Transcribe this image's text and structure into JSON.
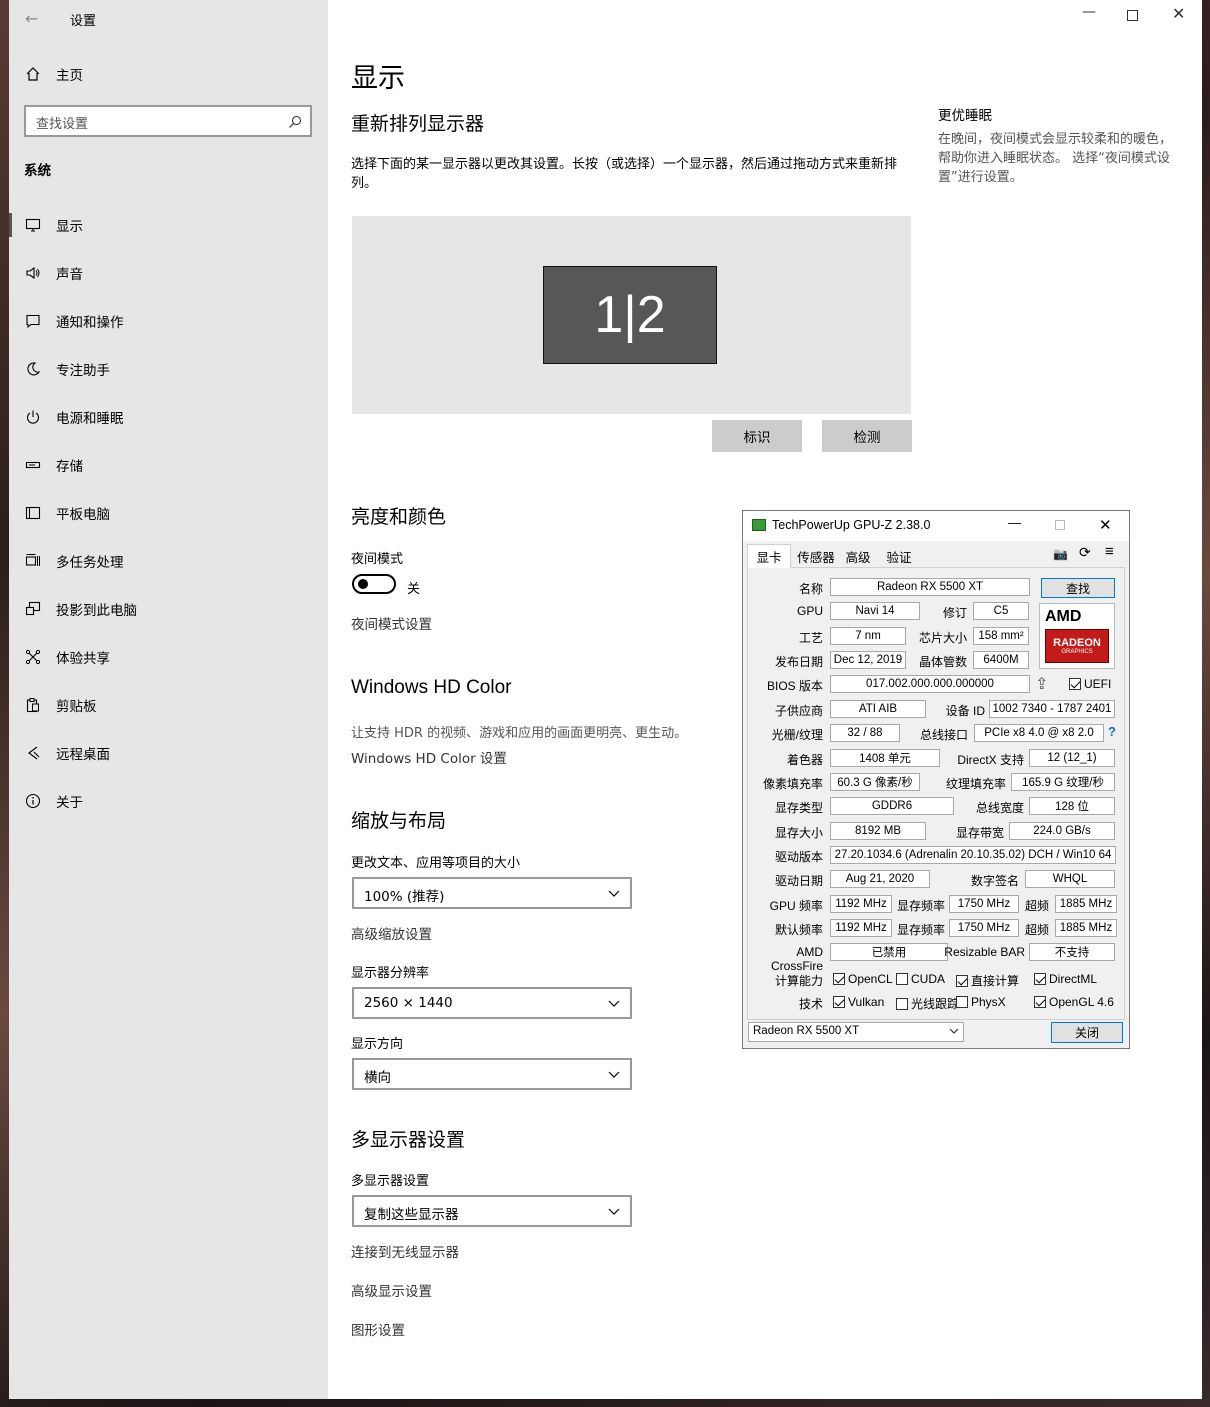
{
  "settings": {
    "title": "设置",
    "home": "主页",
    "search_placeholder": "查找设置",
    "section": "系统",
    "nav": [
      {
        "label": "显示",
        "icon": "monitor-icon"
      },
      {
        "label": "声音",
        "icon": "speaker-icon"
      },
      {
        "label": "通知和操作",
        "icon": "notification-icon"
      },
      {
        "label": "专注助手",
        "icon": "moon-icon"
      },
      {
        "label": "电源和睡眠",
        "icon": "power-icon"
      },
      {
        "label": "存储",
        "icon": "storage-icon"
      },
      {
        "label": "平板电脑",
        "icon": "tablet-icon"
      },
      {
        "label": "多任务处理",
        "icon": "multitask-icon"
      },
      {
        "label": "投影到此电脑",
        "icon": "project-icon"
      },
      {
        "label": "体验共享",
        "icon": "share-icon"
      },
      {
        "label": "剪贴板",
        "icon": "clipboard-icon"
      },
      {
        "label": "远程桌面",
        "icon": "remote-icon"
      },
      {
        "label": "关于",
        "icon": "info-icon"
      }
    ],
    "page_title": "显示",
    "rearrange_heading": "重新排列显示器",
    "rearrange_desc": "选择下面的某一显示器以更改其设置。长按（或选择）一个显示器，然后通过拖动方式来重新排列。",
    "monitor_label": "1|2",
    "identify_button": "标识",
    "detect_button": "检测",
    "sleep_heading": "更优睡眠",
    "sleep_desc": "在晚间，夜间模式会显示较柔和的暖色，帮助你进入睡眠状态。 选择“夜间模式设置”进行设置。",
    "brightness_heading": "亮度和颜色",
    "night_mode_label": "夜间模式",
    "night_mode_state": "关",
    "night_mode_on": false,
    "night_mode_link": "夜间模式设置",
    "hdr_heading": "Windows HD Color",
    "hdr_desc": "让支持 HDR 的视频、游戏和应用的画面更明亮、更生动。",
    "hdr_link": "Windows HD Color 设置",
    "scale_heading": "缩放与布局",
    "scale_label": "更改文本、应用等项目的大小",
    "scale_value": "100% (推荐)",
    "scale_link": "高级缩放设置",
    "resolution_label": "显示器分辨率",
    "resolution_value": "2560 × 1440",
    "orientation_label": "显示方向",
    "orientation_value": "横向",
    "multi_heading": "多显示器设置",
    "multi_label": "多显示器设置",
    "multi_value": "复制这些显示器",
    "wireless_link": "连接到无线显示器",
    "advanced_link": "高级显示设置",
    "graphics_link": "图形设置"
  },
  "gpuz": {
    "title": "TechPowerUp GPU-Z 2.38.0",
    "tabs": [
      "显卡",
      "传感器",
      "高级",
      "验证"
    ],
    "lookup_button": "查找",
    "logo": {
      "brand": "AMD",
      "sub1": "RADEON",
      "sub2": "GRAPHICS"
    },
    "labels": {
      "name": "名称",
      "gpu": "GPU",
      "revision": "修订",
      "tech": "工艺",
      "die_size": "芯片大小",
      "release": "发布日期",
      "transistors": "晶体管数",
      "bios": "BIOS 版本",
      "uefi": "UEFI",
      "subvendor": "子供应商",
      "device_id": "设备 ID",
      "rops": "光栅/纹理",
      "bus": "总线接口",
      "shaders": "着色器",
      "directx": "DirectX 支持",
      "pixel": "像素填充率",
      "texture": "纹理填充率",
      "mem_type": "显存类型",
      "bus_width": "总线宽度",
      "mem_size": "显存大小",
      "bandwidth": "显存带宽",
      "driver": "驱动版本",
      "driver_date": "驱动日期",
      "signature": "数字签名",
      "gpu_clock": "GPU 频率",
      "mem_clock": "显存频率",
      "boost": "超频",
      "default_clock": "默认频率",
      "crossfire": "AMD CrossFire",
      "rebar": "Resizable BAR",
      "compute": "计算能力",
      "technologies": "技术"
    },
    "values": {
      "name": "Radeon RX 5500 XT",
      "gpu": "Navi 14",
      "revision": "C5",
      "tech": "7 nm",
      "die_size": "158 mm²",
      "release": "Dec 12, 2019",
      "transistors": "6400M",
      "bios": "017.002.000.000.000000",
      "subvendor": "ATI AIB",
      "device_id": "1002 7340 - 1787 2401",
      "rops": "32 / 88",
      "bus": "PCIe x8 4.0 @ x8 2.0",
      "shaders": "1408 单元",
      "directx": "12 (12_1)",
      "pixel": "60.3 G 像素/秒",
      "texture": "165.9 G 纹理/秒",
      "mem_type": "GDDR6",
      "bus_width": "128 位",
      "mem_size": "8192 MB",
      "bandwidth": "224.0 GB/s",
      "driver": "27.20.1034.6 (Adrenalin 20.10.35.02) DCH / Win10 64",
      "driver_date": "Aug 21, 2020",
      "signature": "WHQL",
      "gpu_clock": "1192 MHz",
      "mem_clock": "1750 MHz",
      "boost": "1885 MHz",
      "default_clock": "1192 MHz",
      "default_mem": "1750 MHz",
      "default_boost": "1885 MHz",
      "crossfire": "已禁用",
      "rebar": "不支持"
    },
    "uefi_checked": true,
    "compute": [
      {
        "label": "OpenCL",
        "checked": true
      },
      {
        "label": "CUDA",
        "checked": false
      },
      {
        "label": "直接计算",
        "checked": true
      },
      {
        "label": "DirectML",
        "checked": true
      }
    ],
    "tech": [
      {
        "label": "Vulkan",
        "checked": true
      },
      {
        "label": "光线跟踪",
        "checked": false
      },
      {
        "label": "PhysX",
        "checked": false
      },
      {
        "label": "OpenGL 4.6",
        "checked": true
      }
    ],
    "selected_card": "Radeon RX 5500 XT",
    "close_button": "关闭"
  }
}
